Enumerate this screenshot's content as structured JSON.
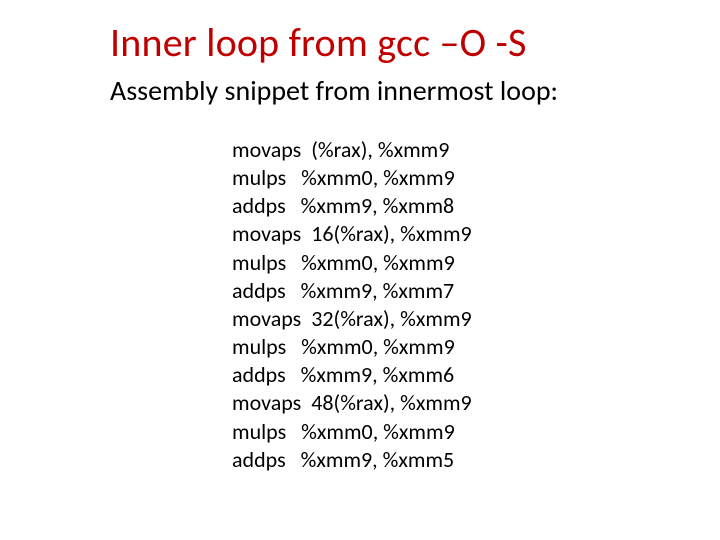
{
  "title": "Inner loop from gcc –O -S",
  "subtitle": "Assembly snippet from innermost loop:",
  "code_lines": [
    "movaps  (%rax), %xmm9",
    "mulps   %xmm0, %xmm9",
    "addps   %xmm9, %xmm8",
    "movaps  16(%rax), %xmm9",
    "mulps   %xmm0, %xmm9",
    "addps   %xmm9, %xmm7",
    "movaps  32(%rax), %xmm9",
    "mulps   %xmm0, %xmm9",
    "addps   %xmm9, %xmm6",
    "movaps  48(%rax), %xmm9",
    "mulps   %xmm0, %xmm9",
    "addps   %xmm9, %xmm5"
  ]
}
